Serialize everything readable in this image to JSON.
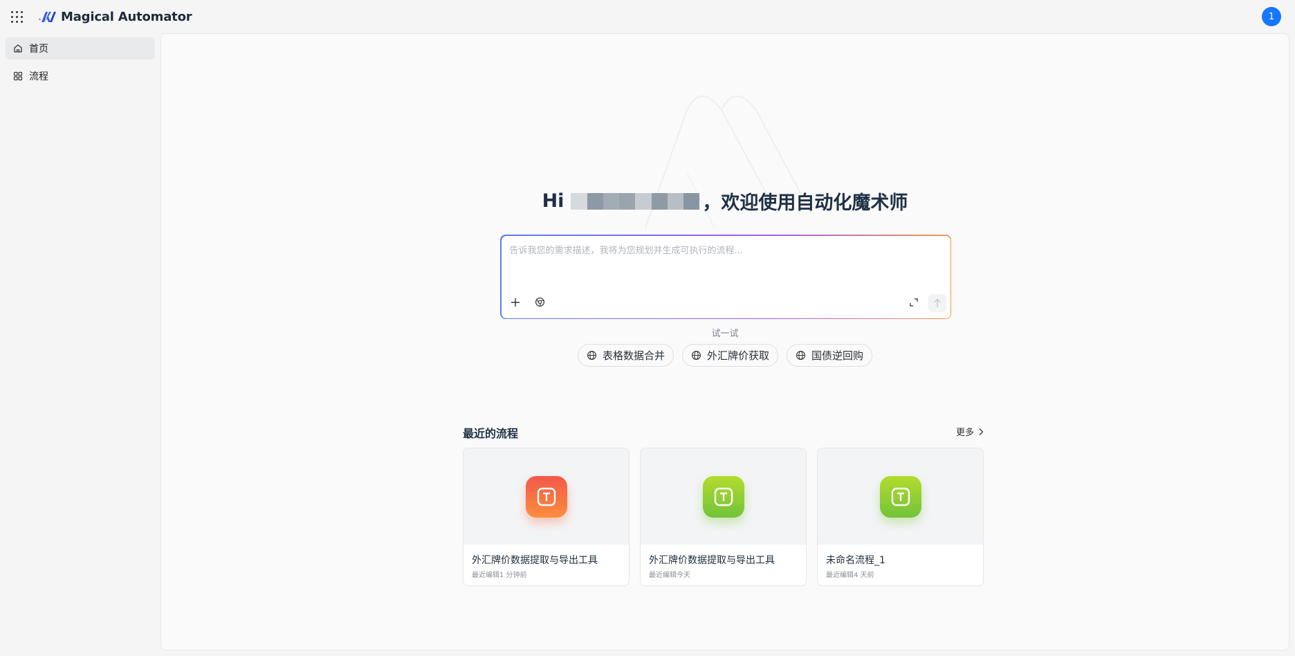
{
  "header": {
    "app_name": "Magical Automator",
    "user_badge": "1",
    "brand_color": "#1677ff"
  },
  "sidebar": {
    "items": [
      {
        "label": "首页",
        "icon": "home-icon",
        "active": true
      },
      {
        "label": "流程",
        "icon": "grid-icon",
        "active": false
      }
    ]
  },
  "main": {
    "greeting_prefix": "Hi",
    "greeting_suffix": "，欢迎使用自动化魔术师",
    "prompt_placeholder": "告诉我您的需求描述，我将为您规划并生成可执行的流程...",
    "try_label": "试一试",
    "suggestions": [
      {
        "label": "表格数据合并",
        "icon": "globe-icon"
      },
      {
        "label": "外汇牌价获取",
        "icon": "globe-icon"
      },
      {
        "label": "国债逆回购",
        "icon": "globe-icon"
      }
    ],
    "recent_title": "最近的流程",
    "more_label": "更多",
    "recent_flows": [
      {
        "title": "外汇牌价数据提取与导出工具",
        "subtitle": "最近编辑1 分钟前",
        "icon_color": "red"
      },
      {
        "title": "外汇牌价数据提取与导出工具",
        "subtitle": "最近编辑今天",
        "icon_color": "green"
      },
      {
        "title": "未命名流程_1",
        "subtitle": "最近编辑4 天前",
        "icon_color": "green"
      }
    ]
  }
}
